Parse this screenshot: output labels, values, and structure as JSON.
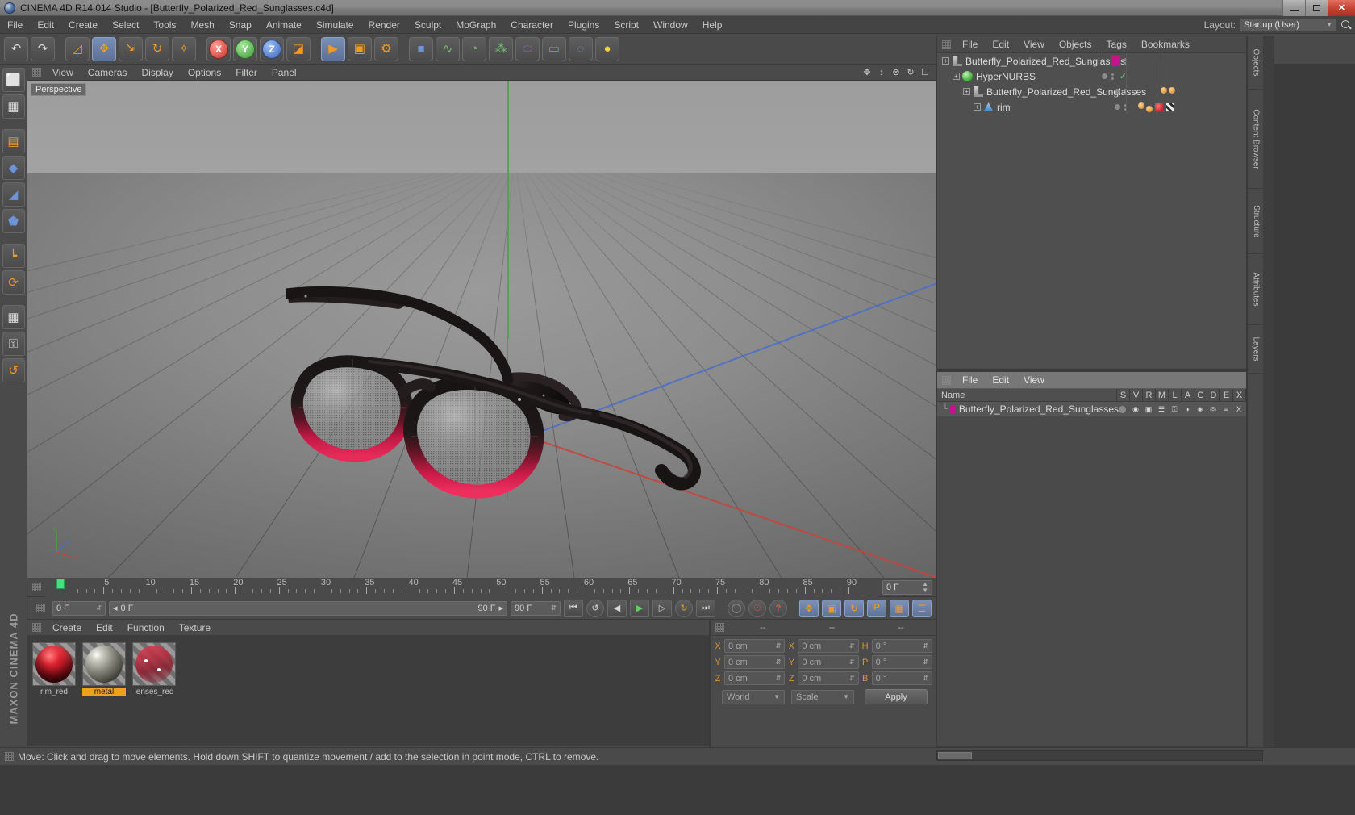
{
  "window": {
    "title": "CINEMA 4D R14.014 Studio - [Butterfly_Polarized_Red_Sunglasses.c4d]",
    "app_icon": "c4d-logo-icon",
    "minimize": "minimize-icon",
    "maximize": "maximize-icon",
    "close": "✕"
  },
  "menubar": {
    "items": [
      "File",
      "Edit",
      "Create",
      "Select",
      "Tools",
      "Mesh",
      "Snap",
      "Animate",
      "Simulate",
      "Render",
      "Sculpt",
      "MoGraph",
      "Character",
      "Plugins",
      "Script",
      "Window",
      "Help"
    ],
    "layout_label": "Layout:",
    "layout_value": "Startup (User)"
  },
  "toolbar": {
    "buttons": [
      {
        "name": "undo",
        "glyph": "↶"
      },
      {
        "name": "redo",
        "glyph": "↷"
      },
      {
        "name": "select-live",
        "glyph": "◱"
      },
      {
        "name": "move",
        "glyph": "✥"
      },
      {
        "name": "scale",
        "glyph": "⤢"
      },
      {
        "name": "rotate",
        "glyph": "↻"
      },
      {
        "name": "move-world",
        "glyph": "✣"
      },
      {
        "name": "axis-x",
        "glyph": "X"
      },
      {
        "name": "axis-y",
        "glyph": "Y"
      },
      {
        "name": "axis-z",
        "glyph": "Z"
      },
      {
        "name": "world-object-coord",
        "glyph": "◰"
      },
      {
        "name": "render-view",
        "glyph": "▶"
      },
      {
        "name": "render-region",
        "glyph": "▣"
      },
      {
        "name": "render-settings",
        "glyph": "⚙"
      },
      {
        "name": "cube-primitive",
        "glyph": "■"
      },
      {
        "name": "spline-pen",
        "glyph": "∿"
      },
      {
        "name": "nurbs-generator",
        "glyph": "◔"
      },
      {
        "name": "array-modeling",
        "glyph": "⁂"
      },
      {
        "name": "deformer",
        "glyph": "⬭"
      },
      {
        "name": "camera",
        "glyph": "▭"
      },
      {
        "name": "floor-environment",
        "glyph": "◌"
      },
      {
        "name": "light",
        "glyph": "●"
      }
    ]
  },
  "left_palette": {
    "buttons": [
      {
        "name": "model-mode",
        "glyph": "⬛"
      },
      {
        "name": "texture-mode",
        "glyph": "▦"
      },
      {
        "name": "polygon-mode",
        "glyph": "▤"
      },
      {
        "name": "point-mode",
        "glyph": "◆"
      },
      {
        "name": "edge-mode",
        "glyph": "◢"
      },
      {
        "name": "model-object-mode",
        "glyph": "⬟"
      },
      {
        "name": "axis-mode",
        "glyph": "┗"
      },
      {
        "name": "enable-snap",
        "glyph": "⟳"
      },
      {
        "name": "viewport-solo",
        "glyph": "▦"
      },
      {
        "name": "lock-axis",
        "glyph": "⚿"
      },
      {
        "name": "workplane",
        "glyph": "↺"
      }
    ],
    "brand": "MAXON CINEMA 4D"
  },
  "viewport": {
    "menus": [
      "View",
      "Cameras",
      "Display",
      "Options",
      "Filter",
      "Panel"
    ],
    "label": "Perspective",
    "right_icons": [
      "pan-icon",
      "dolly-icon",
      "zoom-icon",
      "rotate-icon",
      "maximize-view-icon"
    ],
    "axis_gizmo": {
      "x": "X",
      "y": "Y",
      "z": "Z"
    }
  },
  "timeline": {
    "start_frame": "0 F",
    "end_frame": "90 F",
    "current_frame": "0 F",
    "preview_range": "90 F",
    "ticks": [
      0,
      5,
      10,
      15,
      20,
      25,
      30,
      35,
      40,
      45,
      50,
      55,
      60,
      65,
      70,
      75,
      80,
      85,
      90
    ],
    "transport": [
      {
        "name": "go-to-start",
        "glyph": "⏮"
      },
      {
        "name": "play-backwards-step",
        "glyph": "↺"
      },
      {
        "name": "step-back",
        "glyph": "◀"
      },
      {
        "name": "play",
        "glyph": "▶"
      },
      {
        "name": "step-forward",
        "glyph": "▷"
      },
      {
        "name": "loop",
        "glyph": "↻"
      },
      {
        "name": "go-to-end",
        "glyph": "⏭"
      },
      {
        "name": "record-key",
        "glyph": "●"
      },
      {
        "name": "autokey",
        "glyph": "◎"
      },
      {
        "name": "keyframe-selection",
        "glyph": "?"
      },
      {
        "name": "position-key",
        "glyph": "✥"
      },
      {
        "name": "scale-key",
        "glyph": "▣"
      },
      {
        "name": "rotation-key",
        "glyph": "↻"
      },
      {
        "name": "parameter-key",
        "glyph": "P"
      },
      {
        "name": "pla-key",
        "glyph": "▦"
      },
      {
        "name": "dope-sheet",
        "glyph": "☰"
      }
    ]
  },
  "material_manager": {
    "menus": [
      "Create",
      "Edit",
      "Function",
      "Texture"
    ],
    "materials": [
      {
        "name": "rim_red",
        "selected": false,
        "color": "#c01818"
      },
      {
        "name": "metal",
        "selected": true,
        "color": "#8f8f82"
      },
      {
        "name": "lenses_red",
        "selected": false,
        "color": "#c43040"
      }
    ]
  },
  "coordinates": {
    "headers": [
      "--",
      "--",
      "--"
    ],
    "position": {
      "label_x": "X",
      "label_y": "Y",
      "label_z": "Z",
      "x": "0 cm",
      "y": "0 cm",
      "z": "0 cm"
    },
    "size": {
      "label_x": "X",
      "label_y": "Y",
      "label_z": "Z",
      "x": "0 cm",
      "y": "0 cm",
      "z": "0 cm"
    },
    "rotation": {
      "label_h": "H",
      "label_p": "P",
      "label_b": "B",
      "h": "0 °",
      "p": "0 °",
      "b": "0 °"
    },
    "coord_system": "World",
    "size_mode": "Scale",
    "apply_label": "Apply"
  },
  "object_manager": {
    "menus": [
      "File",
      "Edit",
      "View",
      "Objects",
      "Tags",
      "Bookmarks"
    ],
    "rows": [
      {
        "name": "Butterfly_Polarized_Red_Sunglasses",
        "indent": 0,
        "icon": "null-object-icon",
        "swatch": "#c2158c",
        "has_check": false,
        "tags": []
      },
      {
        "name": "HyperNURBS",
        "indent": 1,
        "icon": "hypernurbs-icon",
        "swatch": null,
        "has_check": true,
        "tags": []
      },
      {
        "name": "Butterfly_Polarized_Red_Sunglasses",
        "indent": 2,
        "icon": "null-object-icon",
        "swatch": null,
        "has_check": false,
        "tags": [
          "tag-dot",
          "tag-dot"
        ]
      },
      {
        "name": "rim",
        "indent": 3,
        "icon": "polygon-object-icon",
        "swatch": null,
        "has_check": false,
        "tags": [
          "tag-dot",
          "tag-dot",
          "texture-tag",
          "uv-tag"
        ]
      }
    ]
  },
  "right_material_panel": {
    "menus": [
      "File",
      "Edit",
      "View"
    ],
    "columns": [
      "Name",
      "S",
      "V",
      "R",
      "M",
      "L",
      "A",
      "G",
      "D",
      "E",
      "X"
    ],
    "rows": [
      {
        "name": "Butterfly_Polarized_Red_Sunglasses",
        "swatch": "#c2158c",
        "icons": [
          "dot-icon",
          "visible-icon",
          "render-icon",
          "hierarchy-icon",
          "lock-icon",
          "animation-icon",
          "generator-icon",
          "deformer-icon",
          "expression-icon",
          "xref-icon"
        ]
      }
    ]
  },
  "right_dock_tabs": [
    "Objects",
    "Content Browser",
    "Structure",
    "Attributes",
    "Layers"
  ],
  "statusbar": {
    "text": "Move: Click and drag to move elements. Hold down SHIFT to quantize movement / add to the selection in point mode, CTRL to remove."
  },
  "colors": {
    "accent_orange": "#f0a020",
    "magenta_swatch": "#c2158c",
    "axis_x": "#c8443c",
    "axis_y": "#4ca04c",
    "axis_z": "#4a6ec8",
    "panel_bg": "#4a4a4a",
    "viewport_bg": "#8e8e8e"
  }
}
